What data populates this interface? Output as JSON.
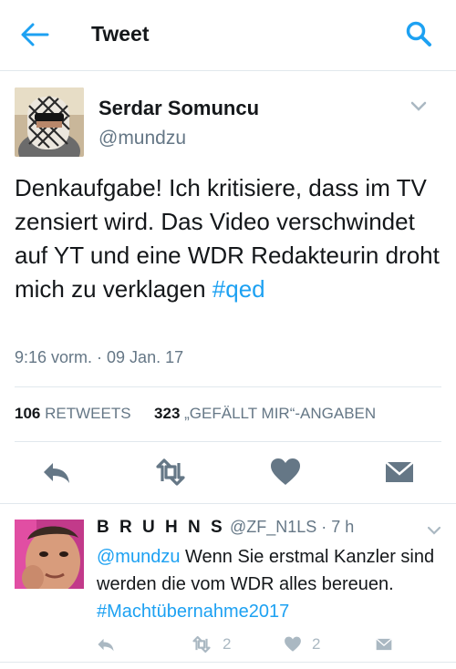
{
  "colors": {
    "accent": "#1da1f2",
    "secondary": "#657786",
    "icon": "#657786",
    "light_icon": "#aab8c2",
    "divider": "#e1e8ed"
  },
  "header": {
    "title": "Tweet",
    "back_icon": "arrow-left-icon",
    "search_icon": "search-icon"
  },
  "tweet": {
    "author_name": "Serdar Somuncu",
    "author_handle": "@mundzu",
    "text_plain": "Denkaufgabe! Ich kritisiere, dass im TV zensiert wird. Das Video verschwindet auf YT und eine WDR Redakteurin droht mich zu verklagen",
    "hashtag": "#qed",
    "timestamp": "9:16 vorm. · 09 Jan. 17",
    "retweets_count": "106",
    "retweets_label": "RETWEETS",
    "likes_count": "323",
    "likes_label": "„GEFÄLLT MIR“-ANGABEN",
    "actions": [
      "reply-icon",
      "retweet-icon",
      "heart-icon",
      "message-icon"
    ]
  },
  "reply": {
    "author_name": "B R U H N S",
    "author_handle": "@ZF_N1LS · 7 h",
    "mention": "@mundzu",
    "text_plain": " Wenn Sie erstmal Kanzler sind werden die vom WDR alles bereuen. ",
    "hashtag": "#Machtübernahme2017",
    "retweet_count": "2",
    "like_count": "2"
  }
}
